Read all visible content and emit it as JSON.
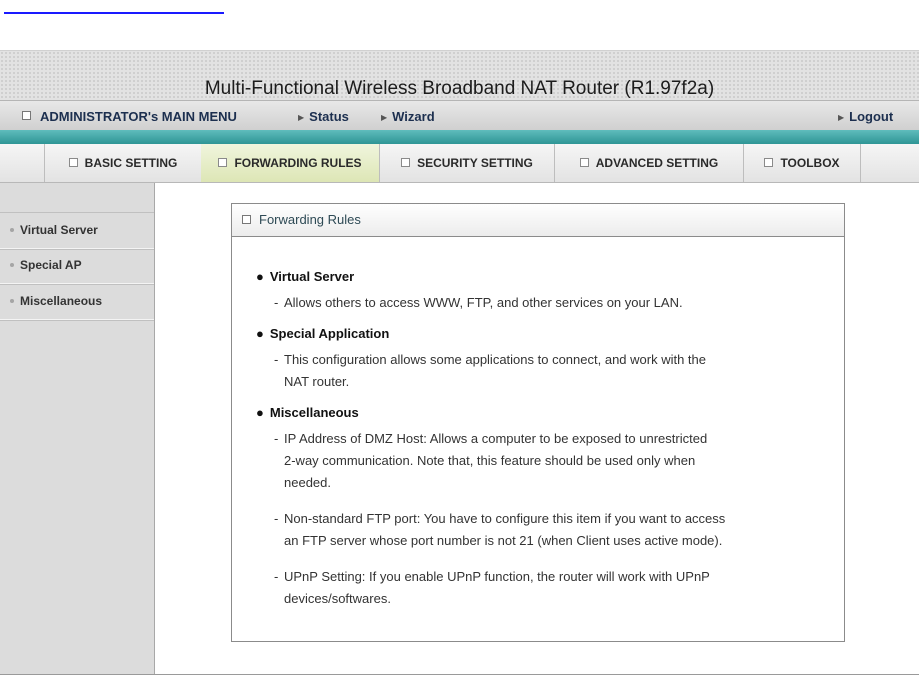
{
  "header": {
    "title": "Multi-Functional Wireless Broadband NAT Router (R1.97f2a)"
  },
  "menu": {
    "admin_label": "ADMINISTRATOR's MAIN MENU",
    "status_label": "Status",
    "wizard_label": "Wizard",
    "logout_label": "Logout"
  },
  "tabs": [
    {
      "label": "BASIC SETTING",
      "active": false
    },
    {
      "label": "FORWARDING RULES",
      "active": true
    },
    {
      "label": "SECURITY SETTING",
      "active": false
    },
    {
      "label": "ADVANCED SETTING",
      "active": false
    },
    {
      "label": "TOOLBOX",
      "active": false
    }
  ],
  "sidebar": {
    "items": [
      {
        "label": "Virtual Server"
      },
      {
        "label": "Special AP"
      },
      {
        "label": "Miscellaneous"
      }
    ]
  },
  "panel": {
    "title": "Forwarding Rules",
    "sections": [
      {
        "title": "Virtual Server",
        "items": [
          {
            "lines": [
              "Allows others to access WWW, FTP, and other services on your LAN."
            ]
          }
        ]
      },
      {
        "title": "Special Application",
        "items": [
          {
            "lines": [
              "This configuration allows some applications to connect, and work with the",
              "NAT router."
            ]
          }
        ]
      },
      {
        "title": "Miscellaneous",
        "items": [
          {
            "lines": [
              "IP Address of DMZ Host: Allows a computer to be exposed to unrestricted",
              "2-way communication. Note that, this feature should be used only when",
              "needed."
            ]
          },
          {
            "lines": [
              "Non-standard FTP port: You have to configure this item if you want to access",
              "an FTP server whose port number is not 21 (when Client uses active mode)."
            ]
          },
          {
            "lines": [
              "UPnP Setting: If you enable UPnP function, the router will work with UPnP",
              "devices/softwares."
            ]
          }
        ]
      }
    ]
  }
}
